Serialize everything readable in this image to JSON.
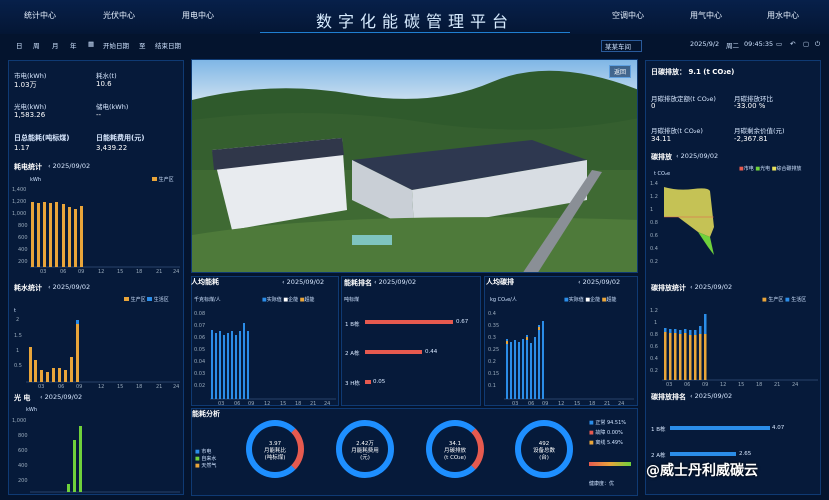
{
  "header": {
    "title": "数字化能碳管理平台",
    "tabs_left": [
      "统计中心",
      "光伏中心",
      "用电中心"
    ],
    "tabs_right": [
      "空调中心",
      "用气中心",
      "用水中心"
    ]
  },
  "subbar": {
    "periods": [
      "日",
      "周",
      "月",
      "年"
    ],
    "start_date": "开始日期",
    "to": "至",
    "end_date": "结束日期",
    "workshop": "某某车间",
    "date": "2025/9/2",
    "weekday": "周二",
    "time": "09:45:35"
  },
  "left_stats": [
    {
      "label": "市电(kWh)",
      "value": "1.03万"
    },
    {
      "label": "耗水(t)",
      "value": "10.6"
    },
    {
      "label": "光电(kWh)",
      "value": "1,583.26"
    },
    {
      "label": "储电(kWh)",
      "value": "--"
    },
    {
      "label": "日总能耗(吨标煤)",
      "value": "1.17"
    },
    {
      "label": "日能耗费用(元)",
      "value": "3,439.22"
    }
  ],
  "elec_chart": {
    "title": "耗电统计",
    "date": "2025/09/02",
    "unit": "kWh",
    "legend": [
      "生产区"
    ]
  },
  "water_chart": {
    "title": "耗水统计",
    "date": "2025/09/02",
    "unit": "t",
    "legend": [
      "生产区",
      "生活区"
    ]
  },
  "pv_chart": {
    "title": "光 电",
    "date": "2025/09/02",
    "unit": "kWh"
  },
  "photo": {
    "back_button": "返回"
  },
  "per_energy": {
    "title": "人均能耗",
    "date": "2025/09/02",
    "unit": "千克标煤/人",
    "legend": [
      "实际值",
      "企能",
      "超能"
    ]
  },
  "rank": {
    "title": "能耗排名",
    "date": "2025/09/02",
    "unit": "吨标煤",
    "items": [
      {
        "name": "1 B栋",
        "value": "0.67"
      },
      {
        "name": "2 A栋",
        "value": "0.44"
      },
      {
        "name": "3 H栋",
        "value": "0.05"
      }
    ]
  },
  "per_carbon": {
    "title": "人均碳排",
    "date": "2025/09/02",
    "unit": "kg CO₂e/人",
    "legend": [
      "实际值",
      "企能",
      "超能"
    ]
  },
  "analysis": {
    "title": "能耗分析",
    "legend": [
      "市电",
      "自来水",
      "天然气"
    ],
    "rings": [
      {
        "value": "3.97",
        "label": "月能耗比",
        "unit": "(吨标煤)"
      },
      {
        "value": "2.42万",
        "label": "月能耗费用",
        "unit": "(元)"
      },
      {
        "value": "34.1",
        "label": "月碳排放",
        "unit": "(t CO₂e)"
      },
      {
        "value": "492",
        "label": "设备总数",
        "unit": "(台)"
      }
    ],
    "status": [
      {
        "label": "正常",
        "value": "94.51%"
      },
      {
        "label": "故障",
        "value": "0.00%"
      },
      {
        "label": "离线",
        "value": "5.49%"
      }
    ],
    "health_label": "健康度：",
    "health": "优"
  },
  "right": {
    "carbon_title": "日碳排放：",
    "carbon_value": "9.1 (t CO₂e)",
    "stats": [
      {
        "label": "月碳排放定额(t CO₂e)",
        "value": "0"
      },
      {
        "label": "月碳排放环比",
        "value": "-33.00 %"
      },
      {
        "label": "月碳排放(t CO₂e)",
        "value": "34.11"
      },
      {
        "label": "月碳剩余价值(元)",
        "value": "-2,367.81"
      }
    ]
  },
  "trend_chart": {
    "title": "碳排放",
    "date": "2025/09/02",
    "unit": "t CO₂e",
    "legend": [
      "市电",
      "光电",
      "综合碳排放"
    ]
  },
  "carbon_stat": {
    "title": "碳排放统计",
    "date": "2025/09/02",
    "legend": [
      "生产区",
      "生活区"
    ]
  },
  "carbon_rank": {
    "title": "碳排放排名",
    "date": "2025/09/02",
    "items": [
      {
        "name": "1 B栋",
        "value": "4.07"
      },
      {
        "name": "2 A栋",
        "value": "2.65"
      }
    ]
  },
  "watermark": "@威士丹利威碳云",
  "colors": {
    "accent": "#1e8fff",
    "bar_orange": "#e9a53a",
    "bar_blue": "#2b8de8",
    "green": "#6fd13b",
    "red": "#e65a4f"
  }
}
